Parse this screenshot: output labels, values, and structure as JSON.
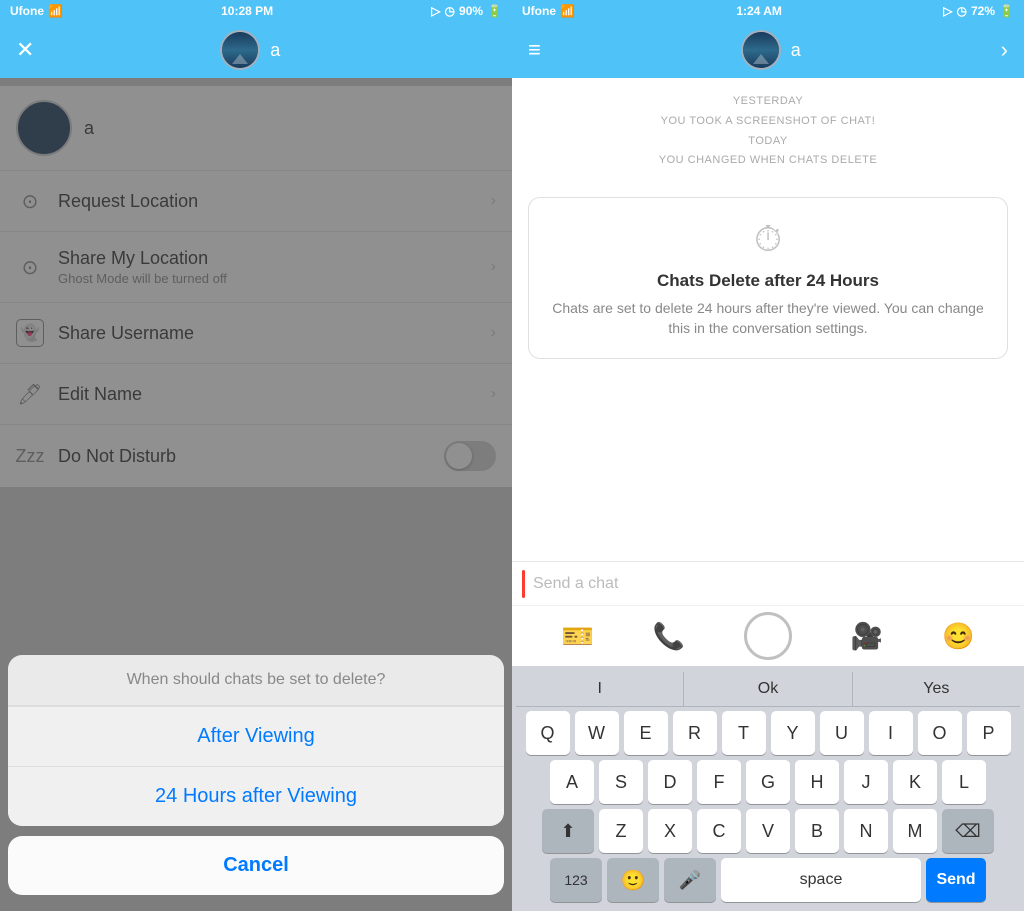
{
  "left": {
    "statusBar": {
      "carrier": "Ufone",
      "time": "10:28 PM",
      "battery": "90%"
    },
    "header": {
      "closeIcon": "✕",
      "avatarAlt": "profile avatar",
      "nameLabel": "a"
    },
    "profile": {
      "name": "a"
    },
    "menuItems": [
      {
        "icon": "📍",
        "title": "Request Location",
        "subtitle": "",
        "hasChevron": true,
        "hasToggle": false
      },
      {
        "icon": "📍",
        "title": "Share My Location",
        "subtitle": "Ghost Mode will be turned off",
        "hasChevron": true,
        "hasToggle": false
      },
      {
        "icon": "👻",
        "title": "Share Username",
        "subtitle": "",
        "hasChevron": true,
        "hasToggle": false
      },
      {
        "icon": "✏️",
        "title": "Edit Name",
        "subtitle": "",
        "hasChevron": true,
        "hasToggle": false
      },
      {
        "icon": "💤",
        "title": "Do Not Disturb",
        "subtitle": "",
        "hasChevron": false,
        "hasToggle": true
      }
    ],
    "actionSheet": {
      "title": "When should chats be set to delete?",
      "options": [
        "After Viewing",
        "24 Hours after Viewing"
      ],
      "cancelLabel": "Cancel"
    }
  },
  "right": {
    "statusBar": {
      "carrier": "Ufone",
      "time": "1:24 AM",
      "battery": "72%"
    },
    "header": {
      "avatarAlt": "profile avatar",
      "nameLabel": "a"
    },
    "systemMessages": [
      "YESTERDAY",
      "YOU TOOK A SCREENSHOT OF CHAT!",
      "TODAY",
      "YOU CHANGED WHEN CHATS DELETE"
    ],
    "deleteNotification": {
      "title": "Chats Delete after 24 Hours",
      "description": "Chats are set to delete 24 hours after they're viewed. You can change this in the conversation settings."
    },
    "chatInput": {
      "placeholder": "Send a chat"
    },
    "keyboard": {
      "suggestions": [
        "I",
        "Ok",
        "Yes"
      ],
      "rows": [
        [
          "Q",
          "W",
          "E",
          "R",
          "T",
          "Y",
          "U",
          "I",
          "O",
          "P"
        ],
        [
          "A",
          "S",
          "D",
          "F",
          "G",
          "H",
          "J",
          "K",
          "L"
        ],
        [
          "Z",
          "X",
          "C",
          "V",
          "B",
          "N",
          "M"
        ]
      ],
      "bottomRow": {
        "numbersKey": "123",
        "spaceKey": "space",
        "sendKey": "Send"
      }
    }
  }
}
